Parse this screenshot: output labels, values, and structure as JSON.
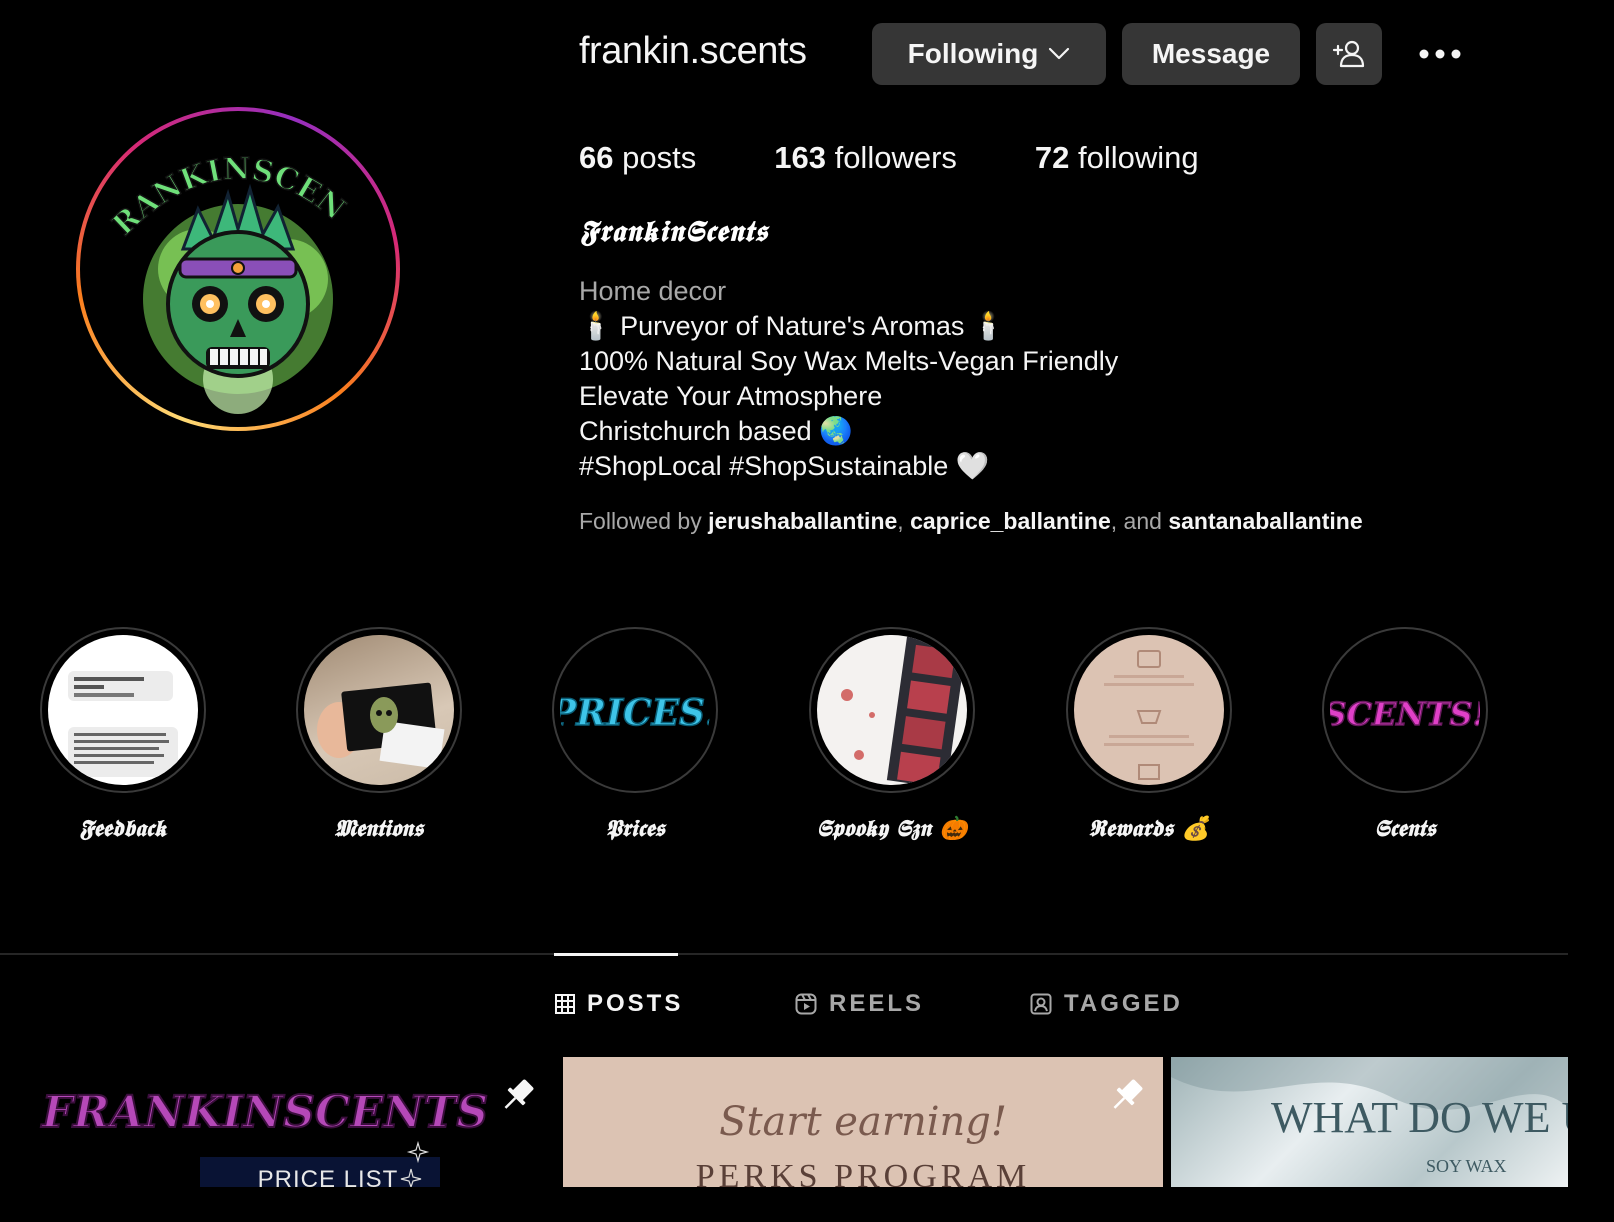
{
  "profile": {
    "username": "frankin.scents",
    "display_name": "𝕱𝖗𝖆𝖓𝖐𝖎𝖓𝕾𝖈𝖊𝖓𝖙𝖘",
    "category": "Home decor",
    "bio_lines": [
      "🕯️ Purveyor of Nature's Aromas 🕯️",
      "100% Natural Soy Wax Melts-Vegan Friendly",
      "Elevate Your Atmosphere",
      "Christchurch based 🌏",
      "#ShopLocal #ShopSustainable 🤍"
    ],
    "avatar_text": "FRANKINSCENTS"
  },
  "actions": {
    "following_label": "Following",
    "message_label": "Message"
  },
  "stats": {
    "posts_count": "66",
    "posts_label": "posts",
    "followers_count": "163",
    "followers_label": "followers",
    "following_count": "72",
    "following_label": "following"
  },
  "followed_by": {
    "prefix": "Followed by ",
    "users": [
      "jerushaballantine",
      "caprice_ballantine",
      "santanaballantine"
    ],
    "sep1": ", ",
    "sep2": ", and "
  },
  "highlights": [
    {
      "label": "𝕱𝖊𝖊𝖉𝖇𝖆𝖈𝖐"
    },
    {
      "label": "𝕸𝖊𝖓𝖙𝖎𝖔𝖓𝖘"
    },
    {
      "label": "𝕻𝖗𝖎𝖈𝖊𝖘",
      "art_text": "PRICES!"
    },
    {
      "label": "𝕾𝖕𝖔𝖔𝖐𝖞 𝕾𝖟𝖓 🎃"
    },
    {
      "label": "𝕽𝖊𝖜𝖆𝖗𝖉𝖘 💰"
    },
    {
      "label": "𝕾𝖈𝖊𝖓𝖙𝖘",
      "art_text": "SCENTS!"
    }
  ],
  "tabs": {
    "posts": "POSTS",
    "reels": "REELS",
    "tagged": "TAGGED"
  },
  "posts": [
    {
      "title": "FRANKINSCENTS",
      "subtitle": "PRICE LIST"
    },
    {
      "script": "Start earning!",
      "title": "PERKS PROGRAM"
    },
    {
      "title": "WHAT DO WE U",
      "subtitle": "SOY WAX"
    }
  ],
  "colors": {
    "background": "#000000",
    "button_bg": "#363636",
    "muted_text": "#a8a8a8",
    "text": "#f5f5f5"
  },
  "icons": [
    "chevron-down-icon",
    "add-user-icon",
    "more-icon",
    "grid-icon",
    "reels-icon",
    "tagged-icon",
    "pin-icon"
  ]
}
